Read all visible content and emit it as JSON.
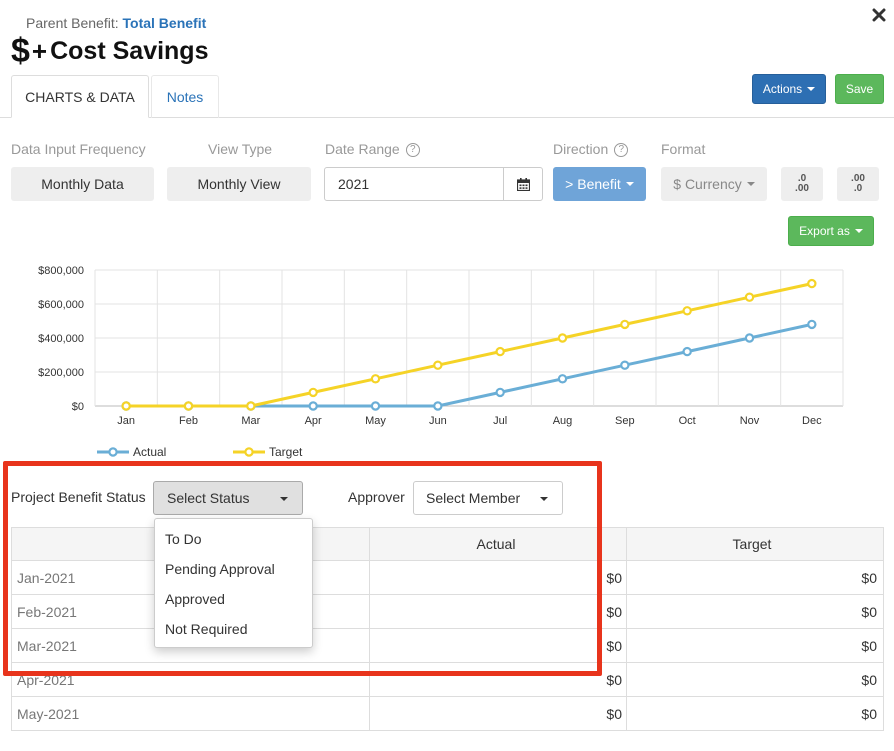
{
  "header": {
    "parent_label": "Parent Benefit:",
    "parent_value": "Total Benefit",
    "dollar_symbol": "$",
    "plus_symbol": "+",
    "title": "Cost Savings"
  },
  "tabs": [
    {
      "label": "CHARTS & DATA",
      "active": true
    },
    {
      "label": "Notes",
      "active": false
    }
  ],
  "buttons": {
    "actions": "Actions",
    "save": "Save",
    "export": "Export as",
    "decimal_increase": [
      ".0",
      ".00"
    ],
    "decimal_decrease": [
      ".00",
      ".0"
    ]
  },
  "filters": {
    "frequency_label": "Data Input Frequency",
    "frequency_value": "Monthly Data",
    "viewtype_label": "View Type",
    "viewtype_value": "Monthly View",
    "daterange_label": "Date Range",
    "daterange_value": "2021",
    "direction_label": "Direction",
    "direction_value": "> Benefit",
    "format_label": "Format",
    "format_value": "$ Currency",
    "help_glyph": "?"
  },
  "chart_data": {
    "type": "line",
    "categories": [
      "Jan",
      "Feb",
      "Mar",
      "Apr",
      "May",
      "Jun",
      "Jul",
      "Aug",
      "Sep",
      "Oct",
      "Nov",
      "Dec"
    ],
    "y_ticks": [
      "$800,000",
      "$600,000",
      "$400,000",
      "$200,000",
      "$0"
    ],
    "ylim": [
      0,
      800000
    ],
    "grid": true,
    "legend_position": "bottom-left",
    "series": [
      {
        "name": "Actual",
        "color": "#6aaed6",
        "values": [
          0,
          0,
          0,
          0,
          0,
          0,
          80000,
          160000,
          240000,
          320000,
          400000,
          480000
        ]
      },
      {
        "name": "Target",
        "color": "#f5d327",
        "values": [
          0,
          0,
          0,
          80000,
          160000,
          240000,
          320000,
          400000,
          480000,
          560000,
          640000,
          720000
        ]
      }
    ]
  },
  "status": {
    "label": "Project Benefit Status",
    "select_value": "Select Status",
    "options": [
      "To Do",
      "Pending Approval",
      "Approved",
      "Not Required"
    ],
    "approver_label": "Approver",
    "approver_value": "Select Member"
  },
  "table": {
    "headers": [
      "",
      "Actual",
      "Target"
    ],
    "rows": [
      {
        "month": "Jan-2021",
        "actual": "$0",
        "target": "$0"
      },
      {
        "month": "Feb-2021",
        "actual": "$0",
        "target": "$0"
      },
      {
        "month": "Mar-2021",
        "actual": "$0",
        "target": "$0"
      },
      {
        "month": "Apr-2021",
        "actual": "$0",
        "target": "$0"
      },
      {
        "month": "May-2021",
        "actual": "$0",
        "target": "$0"
      }
    ]
  },
  "icons": {
    "close": "close-icon",
    "calendar": "calendar-icon",
    "highlight_color": "#e8341c"
  }
}
